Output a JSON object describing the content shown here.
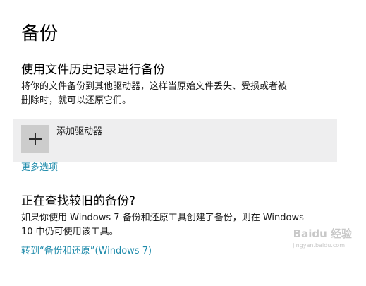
{
  "page": {
    "title": "备份"
  },
  "file_history": {
    "heading": "使用文件历史记录进行备份",
    "description_line1": "将你的文件备份到其他驱动器，这样当原始文件丢失、受损或者被",
    "description_line2": "删除时，就可以还原它们。",
    "add_drive_label": "添加驱动器",
    "more_options_link": "更多选项"
  },
  "older_backup": {
    "heading": "正在查找较旧的备份?",
    "description_line1": "如果你使用 Windows 7 备份和还原工具创建了备份，则在 Windows",
    "description_line2": "10 中仍可使用该工具。",
    "link": "转到“备份和还原”(Windows 7)"
  },
  "watermark": {
    "brand": "Baidu 经验",
    "url": "jingyan.baidu.com"
  },
  "colors": {
    "link": "#1f8bab",
    "tile_bg": "#eeeeef",
    "plus_box_bg": "#cccccc"
  },
  "icons": {
    "add": "plus-icon"
  }
}
